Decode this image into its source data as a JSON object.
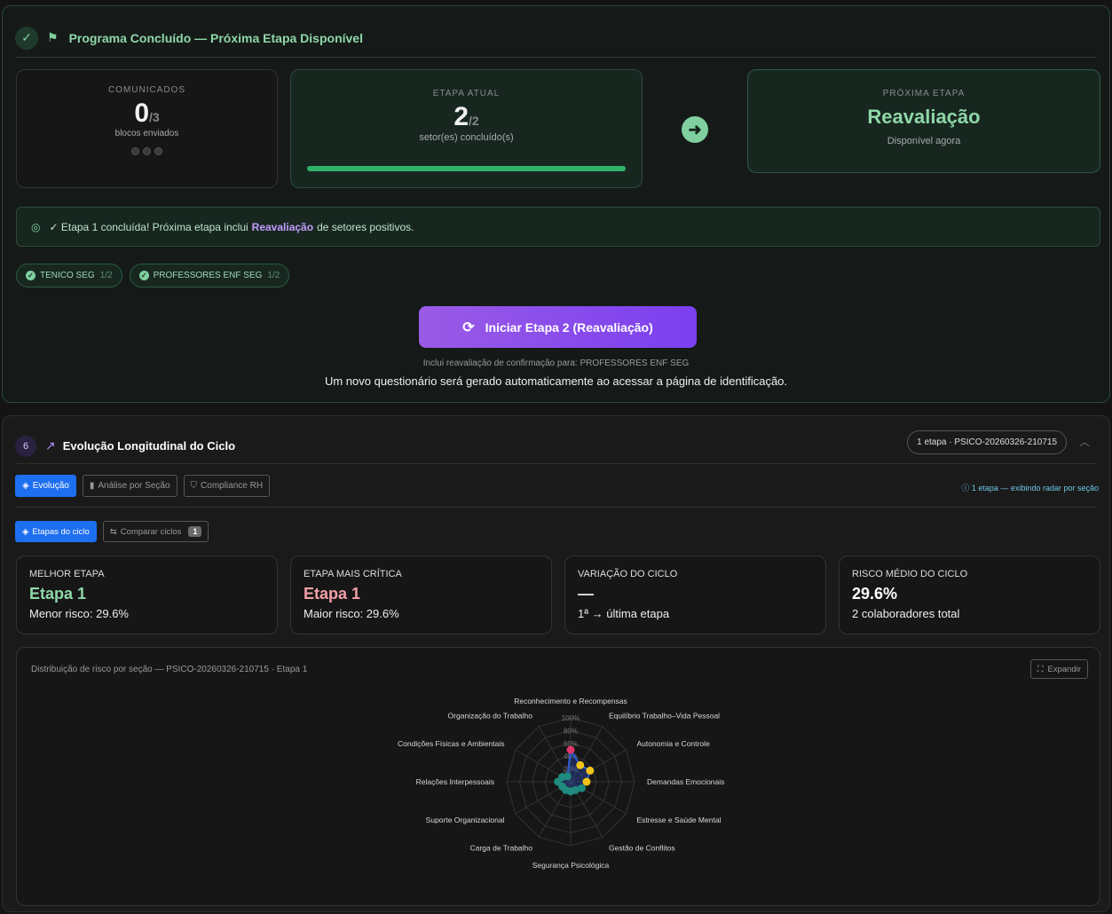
{
  "banner": {
    "title": "Programa Concluído — Próxima Etapa Disponível",
    "check_icon": "✓"
  },
  "comunicados": {
    "label": "COMUNICADOS",
    "value": "0",
    "total": "/3",
    "sub": "blocos enviados"
  },
  "etapa_atual": {
    "label": "ETAPA ATUAL",
    "value": "2",
    "total": "/2",
    "sub": "setor(es) concluído(s)",
    "progress": 1.0
  },
  "proxima": {
    "label": "PRÓXIMA ETAPA",
    "title": "Reavaliação",
    "sub": "Disponível agora"
  },
  "notice": {
    "prefix": "✓ Etapa 1 concluída! Próxima etapa inclui",
    "highlight": "Reavaliação",
    "suffix": "de setores positivos."
  },
  "chips": [
    {
      "label": "TENICO SEG",
      "fraction": "1/2"
    },
    {
      "label": "PROFESSORES ENF SEG",
      "fraction": "1/2"
    }
  ],
  "start_button": "Iniciar Etapa 2 (Reavaliação)",
  "includes_text": "Inclui reavaliação de confirmação para: PROFESSORES ENF SEG",
  "novo_text": "Um novo questionário será gerado automaticamente ao acessar a página de identificação.",
  "section2": {
    "number": "6",
    "title": "Evolução Longitudinal do Ciclo",
    "badge": "1 etapa · PSICO-20260326-210715",
    "tabs": [
      "Evolução",
      "Análise por Seção",
      "Compliance RH"
    ],
    "info_right": "1 etapa — exibindo radar por seção",
    "subtabs": {
      "etapas": "Etapas do ciclo",
      "comparar": "Comparar ciclos",
      "count": "1"
    },
    "stats": [
      {
        "title": "MELHOR ETAPA",
        "value": "Etapa 1",
        "sub": "Menor risco: 29.6%",
        "color": "#8fd7a8"
      },
      {
        "title": "ETAPA MAIS CRÍTICA",
        "value": "Etapa 1",
        "sub": "Maior risco: 29.6%",
        "color": "#f2a0a8"
      },
      {
        "title": "VARIAÇÃO DO CICLO",
        "value": "—",
        "sub": "1ª → última etapa",
        "color": "#dddddd"
      },
      {
        "title": "RISCO MÉDIO DO CICLO",
        "value": "29.6%",
        "sub": "2 colaboradores total",
        "color": "#ffffff"
      }
    ],
    "chart_caption": "Distribuição de risco por seção — PSICO-20260326-210715 · Etapa 1",
    "expand_label": "Expandir"
  },
  "chart_data": {
    "type": "radar",
    "axes": [
      "Reconhecimento e Recompensas",
      "Equilíbrio Trabalho–Vida Pessoal",
      "Autonomia e Controle",
      "Demandas Emocionais",
      "Estresse e Saúde Mental",
      "Gestão de Conflitos",
      "Segurança Psicológica",
      "Carga de Trabalho",
      "Suporte Organizacional",
      "Relações Interpessoais",
      "Condições Físicas e Ambientais",
      "Organização do Trabalho"
    ],
    "values": [
      50,
      30,
      35,
      25,
      20,
      15,
      15,
      15,
      15,
      20,
      15,
      10
    ],
    "point_colors": [
      "#e0366a",
      "#f0c419",
      "#f0c419",
      "#f0c419",
      "#1f8a7e",
      "#1f8a7e",
      "#1f8a7e",
      "#1f8a7e",
      "#1f8a7e",
      "#1f8a7e",
      "#1f8a7e",
      "#1f8a7e"
    ],
    "ticks": [
      "20%",
      "40%",
      "60%",
      "80%",
      "100%"
    ],
    "range": [
      0,
      100
    ]
  }
}
